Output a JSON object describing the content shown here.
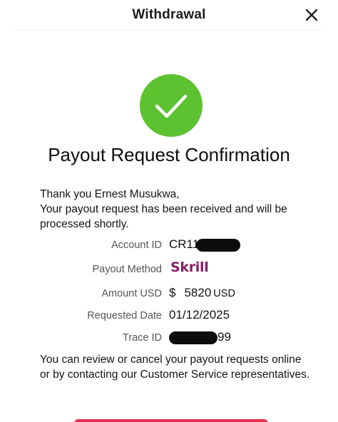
{
  "header": {
    "title": "Withdrawal"
  },
  "confirmation": {
    "heading": "Payout Request Confirmation",
    "greeting": "Thank you Ernest Musukwa,",
    "message": "Your payout request has been received and will be processed shortly."
  },
  "details": {
    "account_id_label": "Account ID",
    "account_id_prefix": "CR11",
    "payout_method_label": "Payout Method",
    "payout_method_value": "Skrill",
    "amount_label": "Amount USD",
    "amount_currency_symbol": "$",
    "amount_value": "5820",
    "amount_unit": "USD",
    "requested_date_label": "Requested Date",
    "requested_date_value": "01/12/2025",
    "trace_id_label": "Trace ID",
    "trace_id_suffix": "99"
  },
  "footer": {
    "note": "You can review or cancel your payout requests online or by contacting our Customer Service representatives."
  },
  "colors": {
    "success_green": "#5cc22f",
    "skrill_purple": "#862165",
    "button_red": "#e2314f"
  },
  "icons": {
    "close": "close-icon",
    "success": "checkmark-icon"
  }
}
